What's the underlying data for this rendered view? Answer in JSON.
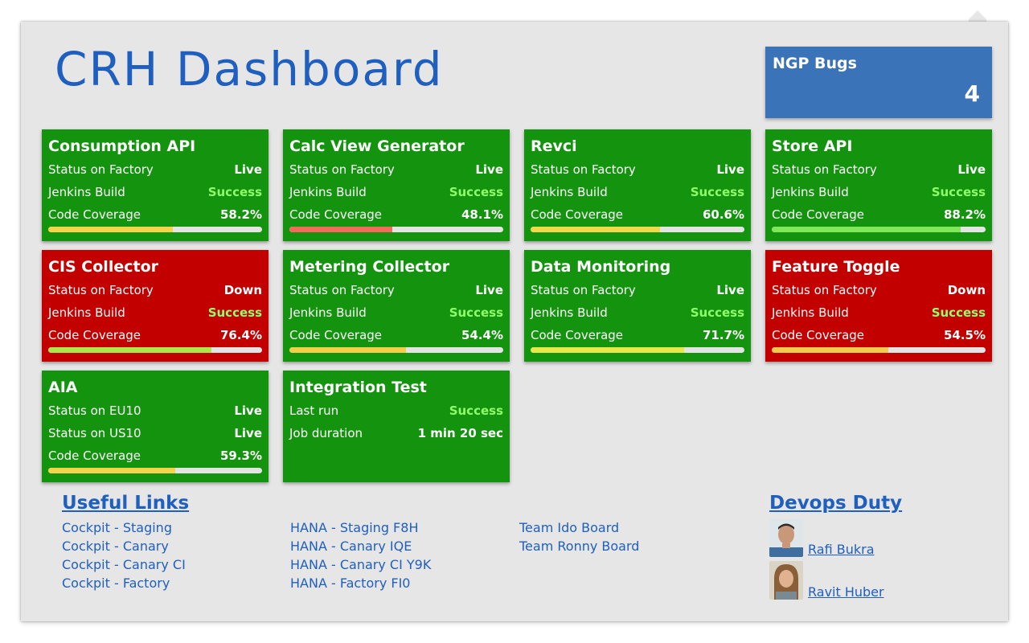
{
  "header": {
    "title": "CRH Dashboard"
  },
  "bugs": {
    "title": "NGP Bugs",
    "count": "4",
    "color": "#3b73b9"
  },
  "colors": {
    "green": "#14930f",
    "red": "#c20000",
    "success_text": "#8fff6a",
    "link": "#1f5fbf"
  },
  "cards": [
    {
      "name": "Consumption API",
      "status": "green",
      "rows": [
        [
          "Status on Factory",
          "Live"
        ],
        [
          "Jenkins Build",
          "Success"
        ],
        [
          "Code Coverage",
          "58.2%"
        ]
      ],
      "coverage": 58.2,
      "bar_color": "#f5d34a"
    },
    {
      "name": "Calc View Generator",
      "status": "green",
      "rows": [
        [
          "Status on Factory",
          "Live"
        ],
        [
          "Jenkins Build",
          "Success"
        ],
        [
          "Code Coverage",
          "48.1%"
        ]
      ],
      "coverage": 48.1,
      "bar_color": "#f36a5a"
    },
    {
      "name": "Revci",
      "status": "green",
      "rows": [
        [
          "Status on Factory",
          "Live"
        ],
        [
          "Jenkins Build",
          "Success"
        ],
        [
          "Code Coverage",
          "60.6%"
        ]
      ],
      "coverage": 60.6,
      "bar_color": "#f3d84a"
    },
    {
      "name": "Store API",
      "status": "green",
      "rows": [
        [
          "Status on Factory",
          "Live"
        ],
        [
          "Jenkins Build",
          "Success"
        ],
        [
          "Code Coverage",
          "88.2%"
        ]
      ],
      "coverage": 88.2,
      "bar_color": "#7ee85a"
    },
    {
      "name": "CIS Collector",
      "status": "red",
      "rows": [
        [
          "Status on Factory",
          "Down"
        ],
        [
          "Jenkins Build",
          "Success"
        ],
        [
          "Code Coverage",
          "76.4%"
        ]
      ],
      "coverage": 76.4,
      "bar_color": "#a8e84a"
    },
    {
      "name": "Metering Collector",
      "status": "green",
      "rows": [
        [
          "Status on Factory",
          "Live"
        ],
        [
          "Jenkins Build",
          "Success"
        ],
        [
          "Code Coverage",
          "54.4%"
        ]
      ],
      "coverage": 54.4,
      "bar_color": "#f5cf4a"
    },
    {
      "name": "Data Monitoring",
      "status": "green",
      "rows": [
        [
          "Status on Factory",
          "Live"
        ],
        [
          "Jenkins Build",
          "Success"
        ],
        [
          "Code Coverage",
          "71.7%"
        ]
      ],
      "coverage": 71.7,
      "bar_color": "#e8e84a"
    },
    {
      "name": "Feature Toggle",
      "status": "red",
      "rows": [
        [
          "Status on Factory",
          "Down"
        ],
        [
          "Jenkins Build",
          "Success"
        ],
        [
          "Code Coverage",
          "54.5%"
        ]
      ],
      "coverage": 54.5,
      "bar_color": "#f5c94a"
    },
    {
      "name": "AIA",
      "status": "green",
      "rows": [
        [
          "Status on EU10",
          "Live"
        ],
        [
          "Status on US10",
          "Live"
        ],
        [
          "Code Coverage",
          "59.3%"
        ]
      ],
      "coverage": 59.3,
      "bar_color": "#f5d34a"
    },
    {
      "name": "Integration Test",
      "status": "green",
      "rows": [
        [
          "Last run",
          "Success"
        ],
        [
          "Job duration",
          "1 min 20 sec"
        ]
      ]
    }
  ],
  "useful_links": {
    "title": "Useful Links",
    "columns": [
      [
        "Cockpit - Staging",
        "Cockpit - Canary",
        "Cockpit - Canary CI",
        "Cockpit - Factory"
      ],
      [
        "HANA - Staging F8H",
        "HANA - Canary IQE",
        "HANA - Canary CI Y9K",
        "HANA - Factory FI0"
      ],
      [
        "Team Ido Board",
        "Team Ronny Board"
      ]
    ]
  },
  "devops": {
    "title": "Devops Duty",
    "people": [
      {
        "name": "Rafi Bukra",
        "avatar_icon": "person-photo-icon"
      },
      {
        "name": "Ravit Huber",
        "avatar_icon": "person-photo-icon"
      }
    ]
  }
}
